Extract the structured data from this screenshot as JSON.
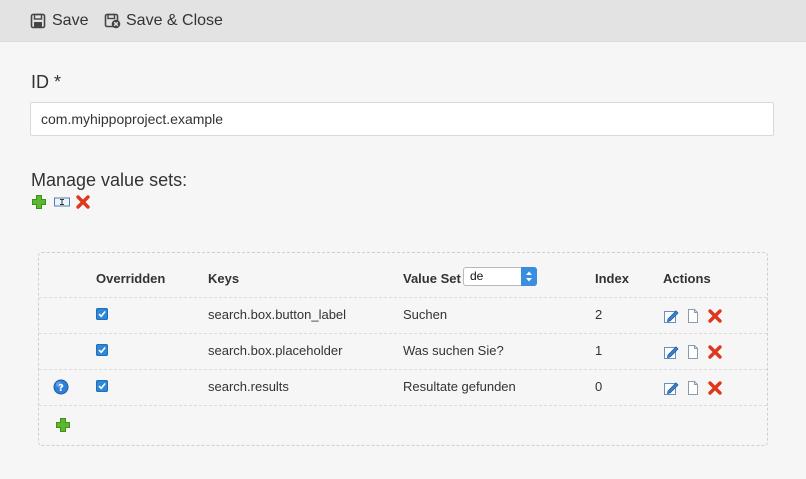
{
  "toolbar": {
    "save_label": "Save",
    "save_close_label": "Save & Close"
  },
  "form": {
    "id_label": "ID *",
    "id_value": "com.myhippoproject.example",
    "manage_label": "Manage value sets:"
  },
  "table": {
    "headers": {
      "overridden": "Overridden",
      "keys": "Keys",
      "value_set": "Value Set",
      "index": "Index",
      "actions": "Actions"
    },
    "value_set_selected": "de",
    "rows": [
      {
        "overridden": true,
        "key": "search.box.button_label",
        "value": "Suchen",
        "index": "2"
      },
      {
        "overridden": true,
        "key": "search.box.placeholder",
        "value": "Was suchen Sie?",
        "index": "1"
      },
      {
        "overridden": true,
        "key": "search.results",
        "value": "Resultate gefunden",
        "index": "0",
        "help": true
      }
    ]
  },
  "colors": {
    "add_green": "#5cb82e",
    "delete_red": "#e0361c",
    "checkbox_blue": "#2d89d8",
    "help_blue": "#2f7fd6"
  },
  "icons": {
    "save": "floppy-disk-icon",
    "save_close": "floppy-disk-close-icon",
    "add": "plus-icon",
    "rename": "rename-icon",
    "delete": "delete-x-icon",
    "edit": "edit-pencil-icon",
    "copy": "copy-page-icon",
    "help": "help-icon"
  }
}
